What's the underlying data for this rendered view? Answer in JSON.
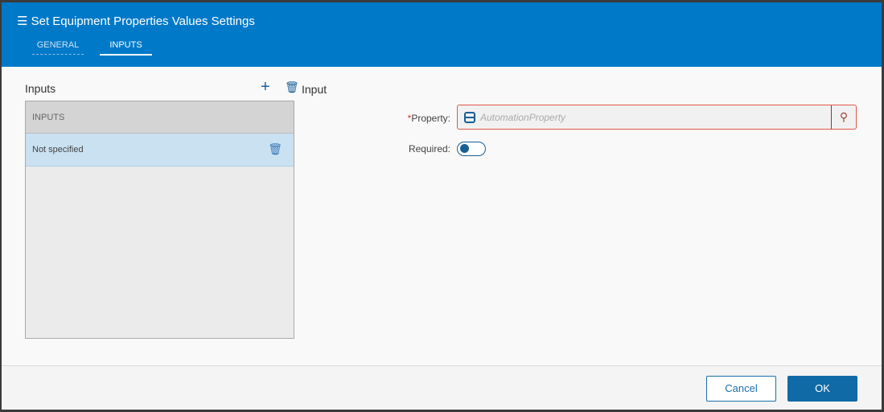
{
  "header": {
    "title": "Set Equipment Properties Values Settings",
    "tabs": [
      "GENERAL",
      "INPUTS"
    ]
  },
  "left": {
    "title": "Inputs",
    "list_header": "INPUTS",
    "items": [
      {
        "label": "Not specified"
      }
    ]
  },
  "right": {
    "title": "Input",
    "property_label": "Property:",
    "property_placeholder": "AutomationProperty",
    "required_label": "Required:",
    "required_value": false
  },
  "footer": {
    "cancel": "Cancel",
    "ok": "OK"
  },
  "colors": {
    "accent": "#0079c8"
  }
}
